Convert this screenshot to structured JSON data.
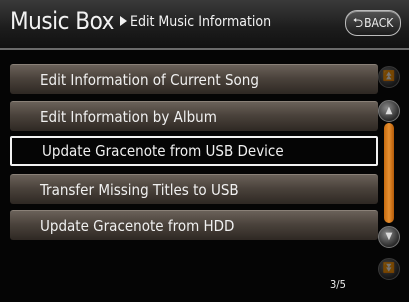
{
  "header": {
    "title": "Music Box",
    "subtitle": "Edit Music Information",
    "back_label": "BACK"
  },
  "menu": {
    "items": [
      {
        "label": "Edit Information of Current Song"
      },
      {
        "label": "Edit Information by Album"
      },
      {
        "label": "Update Gracenote from USB Device"
      },
      {
        "label": "Transfer Missing Titles to USB"
      },
      {
        "label": "Update Gracenote from HDD"
      }
    ],
    "selected_index": 2
  },
  "pagination": {
    "indicator": "3/5"
  },
  "colors": {
    "accent": "#e08a28",
    "item_background": "#4b433c",
    "selected_border": "#f2f2f2"
  }
}
